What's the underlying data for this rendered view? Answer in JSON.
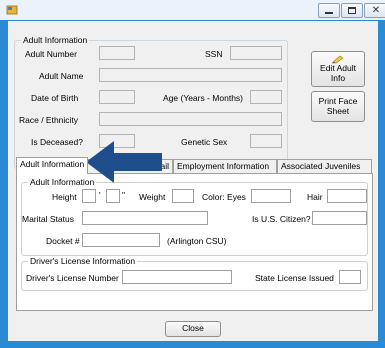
{
  "window": {
    "close_glyph": "✕"
  },
  "adult_info": {
    "group_label": "Adult Information",
    "adult_number_label": "Adult Number",
    "ssn_label": "SSN",
    "adult_name_label": "Adult Name",
    "dob_label": "Date of Birth",
    "age_label": "Age (Years - Months)",
    "race_label": "Race / Ethnicity",
    "deceased_label": "Is Deceased?",
    "genetic_sex_label": "Genetic Sex"
  },
  "buttons": {
    "edit_line1": "Edit Adult",
    "edit_line2": "Info",
    "print_line1": "Print Face",
    "print_line2": "Sheet",
    "close": "Close"
  },
  "tabs": [
    {
      "label": "Adult Information"
    },
    {
      "label": "s / Email"
    },
    {
      "label": "Employment Information"
    },
    {
      "label": "Associated Juveniles"
    }
  ],
  "panel": {
    "group_label": "Adult Information",
    "height_label": "Height",
    "feet_mark": "'",
    "inch_mark": "\"",
    "weight_label": "Weight",
    "color_eyes_label": "Color: Eyes",
    "hair_label": "Hair",
    "marital_label": "Marital Status",
    "citizen_label": "Is U.S. Citizen?",
    "docket_label": "Docket #",
    "docket_note": "(Arlington CSU)",
    "dl_group_label": "Driver's License Information",
    "dl_number_label": "Driver's License Number",
    "state_issued_label": "State License Issued"
  },
  "colors": {
    "title_bg": "#eaf2fb",
    "frame": "#2a8ad4",
    "arrow": "#1f4e8c"
  }
}
